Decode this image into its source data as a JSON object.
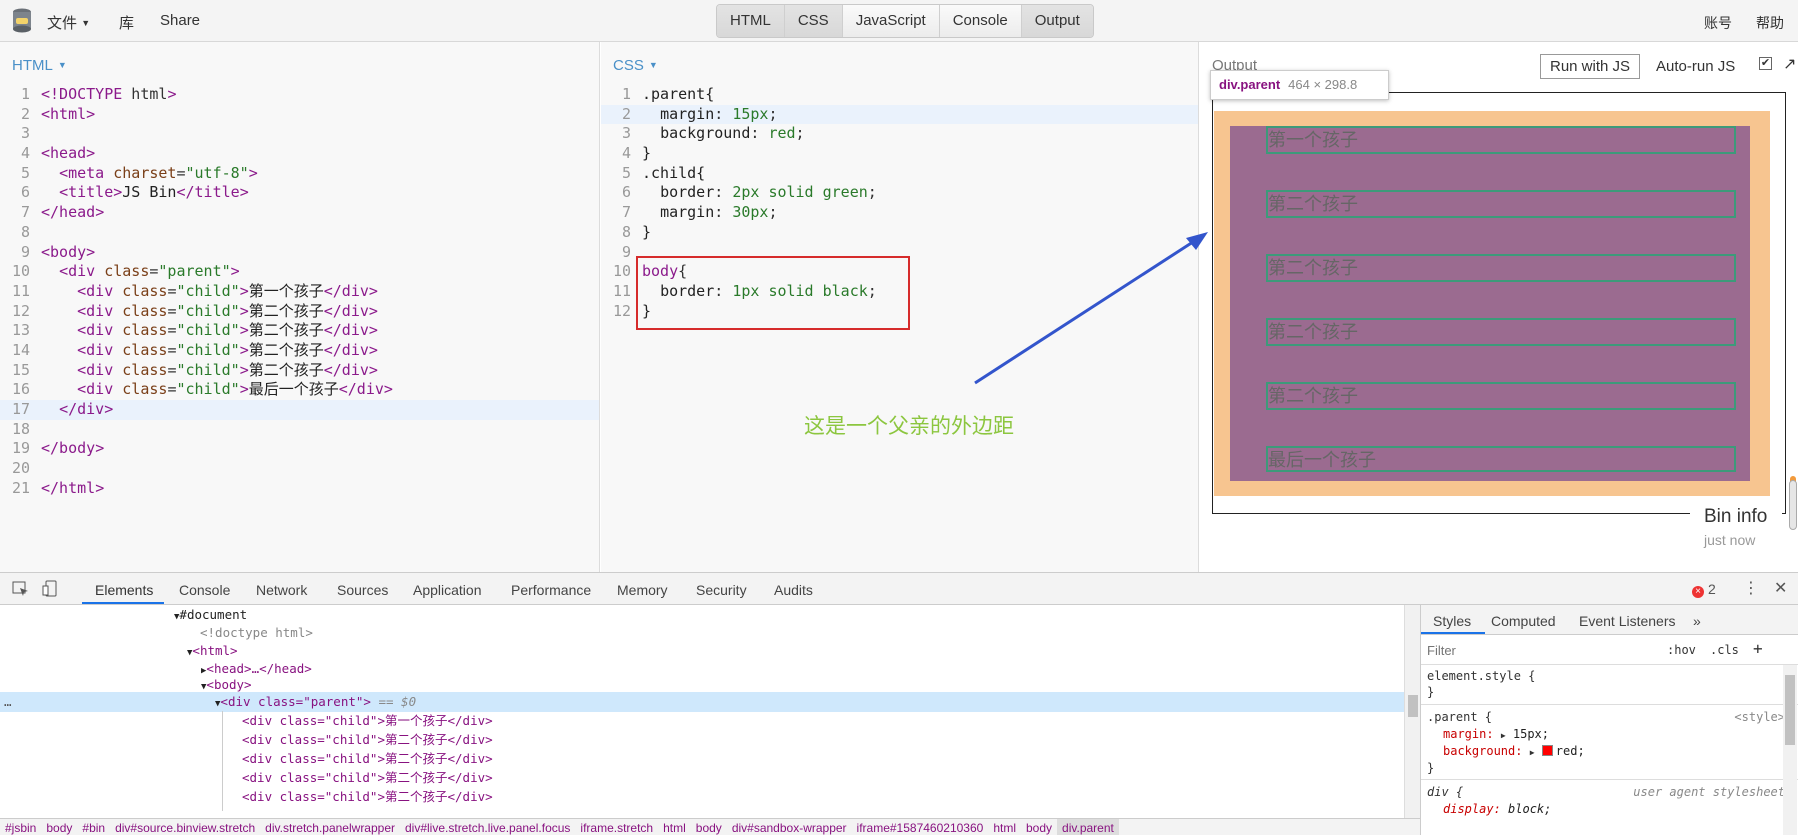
{
  "topbar": {
    "file_label": "文件",
    "library_label": "库",
    "share_label": "Share",
    "panel_tabs": [
      "HTML",
      "CSS",
      "JavaScript",
      "Console",
      "Output"
    ],
    "account_label": "账号",
    "help_label": "帮助"
  },
  "html_panel": {
    "label": "HTML",
    "lines": [
      {
        "n": "1",
        "code": "<!DOCTYPE html>"
      },
      {
        "n": "2",
        "code": "<html>"
      },
      {
        "n": "3",
        "code": ""
      },
      {
        "n": "4",
        "code": "<head>"
      },
      {
        "n": "5",
        "code": "  <meta charset=\"utf-8\">"
      },
      {
        "n": "6",
        "code": "  <title>JS Bin</title>"
      },
      {
        "n": "7",
        "code": "</head>"
      },
      {
        "n": "8",
        "code": ""
      },
      {
        "n": "9",
        "code": "<body>"
      },
      {
        "n": "10",
        "code": "  <div class=\"parent\">"
      },
      {
        "n": "11",
        "code": "    <div class=\"child\">第一个孩子</div>"
      },
      {
        "n": "12",
        "code": "    <div class=\"child\">第二个孩子</div>"
      },
      {
        "n": "13",
        "code": "    <div class=\"child\">第二个孩子</div>"
      },
      {
        "n": "14",
        "code": "    <div class=\"child\">第二个孩子</div>"
      },
      {
        "n": "15",
        "code": "    <div class=\"child\">第二个孩子</div>"
      },
      {
        "n": "16",
        "code": "    <div class=\"child\">最后一个孩子</div>"
      },
      {
        "n": "17",
        "code": "  </div>"
      },
      {
        "n": "18",
        "code": ""
      },
      {
        "n": "19",
        "code": "</body>"
      },
      {
        "n": "20",
        "code": ""
      },
      {
        "n": "21",
        "code": "</html>"
      }
    ]
  },
  "css_panel": {
    "label": "CSS",
    "lines": [
      {
        "n": "1",
        "code": ".parent{"
      },
      {
        "n": "2",
        "code": "  margin: 15px;"
      },
      {
        "n": "3",
        "code": "  background: red;"
      },
      {
        "n": "4",
        "code": "}"
      },
      {
        "n": "5",
        "code": ".child{"
      },
      {
        "n": "6",
        "code": "  border: 2px solid green;"
      },
      {
        "n": "7",
        "code": "  margin: 30px;"
      },
      {
        "n": "8",
        "code": "}"
      },
      {
        "n": "9",
        "code": ""
      },
      {
        "n": "10",
        "code": "body{"
      },
      {
        "n": "11",
        "code": "  border: 1px solid black;"
      },
      {
        "n": "12",
        "code": "}"
      }
    ]
  },
  "annotation": "这是一个父亲的外边距",
  "output_panel": {
    "label": "Output",
    "run_button": "Run with JS",
    "autorun_label": "Auto-run JS",
    "autorun_checked": true,
    "tooltip_selector": "div.parent",
    "tooltip_size": "464 × 298.8",
    "children": [
      "第一个孩子",
      "第二个孩子",
      "第二个孩子",
      "第二个孩子",
      "第二个孩子",
      "最后一个孩子"
    ],
    "bin_info_title": "Bin info",
    "bin_info_time": "just now",
    "colors": {
      "margin": "#f7c590",
      "content": "#9b6b90",
      "child_border": "#3d9a7a"
    }
  },
  "devtools": {
    "tabs": [
      "Elements",
      "Console",
      "Network",
      "Sources",
      "Application",
      "Performance",
      "Memory",
      "Security",
      "Audits"
    ],
    "error_count": "2",
    "tree": {
      "document": "#document",
      "doctype": "<!doctype html>",
      "html_open": "<html>",
      "head": "<head>…</head>",
      "body_open": "<body>",
      "parent_div": "<div class=\"parent\">",
      "parent_marker": "== $0",
      "children": [
        "<div class=\"child\">第一个孩子</div>",
        "<div class=\"child\">第二个孩子</div>",
        "<div class=\"child\">第二个孩子</div>",
        "<div class=\"child\">第二个孩子</div>",
        "<div class=\"child\">第二个孩子</div>"
      ]
    },
    "breadcrumbs": [
      "#jsbin",
      "body",
      "#bin",
      "div#source.binview.stretch",
      "div.stretch.panelwrapper",
      "div#live.stretch.live.panel.focus",
      "iframe.stretch",
      "html",
      "body",
      "div#sandbox-wrapper",
      "iframe#1587460210360",
      "html",
      "body",
      "div.parent"
    ],
    "styles": {
      "tabs": [
        "Styles",
        "Computed",
        "Event Listeners"
      ],
      "filter_placeholder": "Filter",
      "hov": ":hov",
      ".cls": ".cls",
      "element_style": "element.style {",
      "close_brace": "}",
      "parent_rule": ".parent {",
      "parent_source": "<style>",
      "margin_prop": "margin:",
      "margin_val": "15px;",
      "bg_prop": "background:",
      "bg_val": "red;",
      "div_rule": "div {",
      "div_source": "user agent stylesheet",
      "display_prop": "display:",
      "display_val": "block;"
    }
  }
}
